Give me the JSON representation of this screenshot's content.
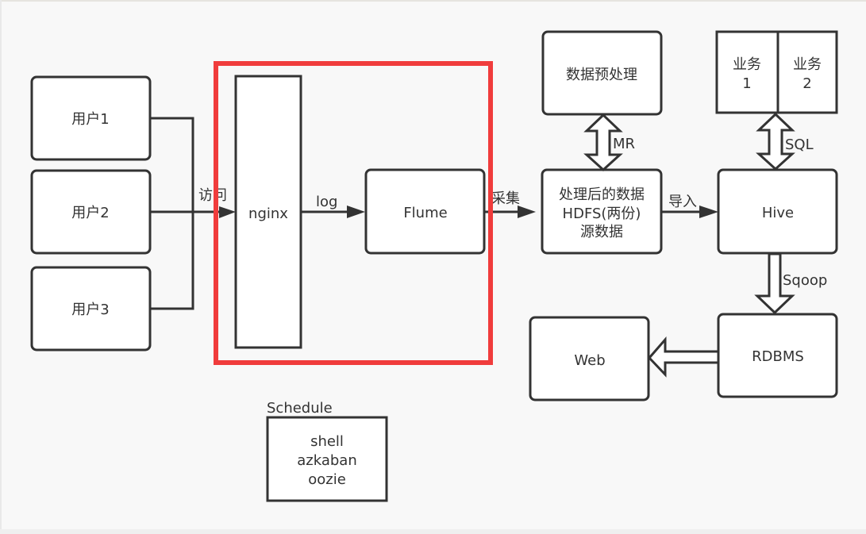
{
  "diagram": {
    "users": [
      "用户1",
      "用户2",
      "用户3"
    ],
    "nginx": "nginx",
    "flume": "Flume",
    "processed": [
      "处理后的数据",
      "HDFS(两份)",
      "源数据"
    ],
    "preprocess": "数据预处理",
    "business1": [
      "业务",
      "1"
    ],
    "business2": [
      "业务",
      "2"
    ],
    "hive": "Hive",
    "rdbms": "RDBMS",
    "web": "Web",
    "schedule_title": "Schedule",
    "schedule_items": [
      "shell",
      "azkaban",
      "oozie"
    ],
    "edges": {
      "access": "访问",
      "log": "log",
      "collect": "采集",
      "import": "导入",
      "mr": "MR",
      "sql": "SQL",
      "sqoop": "Sqoop"
    },
    "highlight_color": "#f03c3c"
  }
}
